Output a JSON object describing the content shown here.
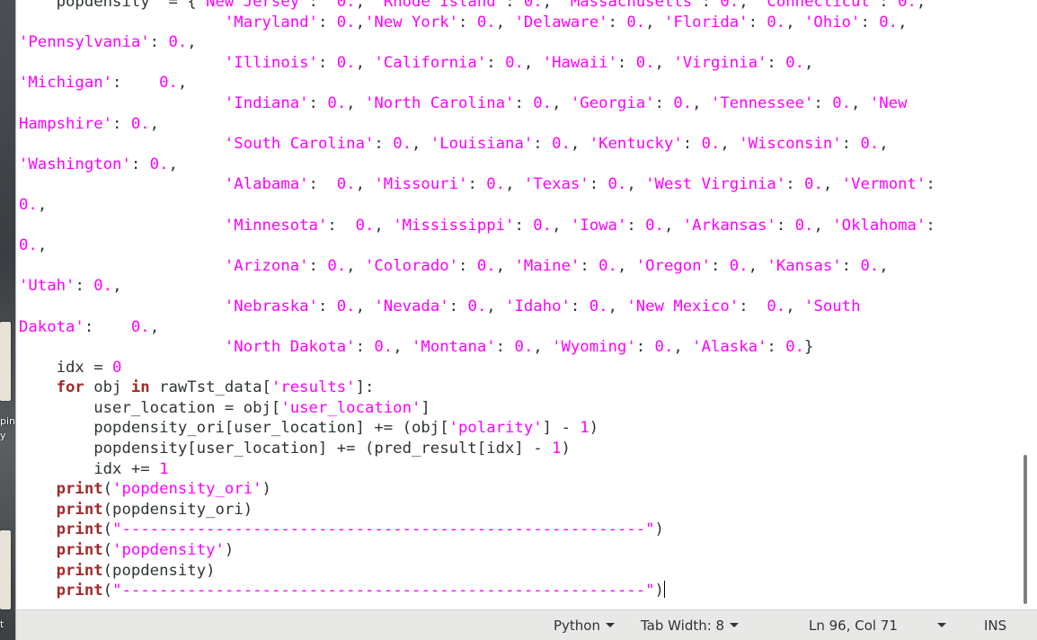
{
  "desktop": {
    "label_fragment_1": "pin",
    "label_fragment_2": "y",
    "label_fragment_3": "t"
  },
  "editor": {
    "code_lines": [
      [
        [
          "    popdensity  = {",
          "plain"
        ],
        [
          "'New Jersey'",
          "str"
        ],
        [
          ":  ",
          "plain"
        ],
        [
          "0.",
          "num"
        ],
        [
          ", ",
          "plain"
        ],
        [
          "'Rhode Island'",
          "str"
        ],
        [
          ": ",
          "plain"
        ],
        [
          "0.",
          "num"
        ],
        [
          ", ",
          "plain"
        ],
        [
          "'Massachusetts'",
          "str"
        ],
        [
          ": ",
          "plain"
        ],
        [
          "0.",
          "num"
        ],
        [
          ", ",
          "plain"
        ],
        [
          "'Connecticut'",
          "str"
        ],
        [
          ": ",
          "plain"
        ],
        [
          "0.",
          "num"
        ],
        [
          ",",
          "plain"
        ]
      ],
      [
        [
          "                      ",
          "plain"
        ],
        [
          "'Maryland'",
          "str"
        ],
        [
          ": ",
          "plain"
        ],
        [
          "0.",
          "num"
        ],
        [
          ",",
          "plain"
        ],
        [
          "'New York'",
          "str"
        ],
        [
          ": ",
          "plain"
        ],
        [
          "0.",
          "num"
        ],
        [
          ", ",
          "plain"
        ],
        [
          "'Delaware'",
          "str"
        ],
        [
          ": ",
          "plain"
        ],
        [
          "0.",
          "num"
        ],
        [
          ", ",
          "plain"
        ],
        [
          "'Florida'",
          "str"
        ],
        [
          ": ",
          "plain"
        ],
        [
          "0.",
          "num"
        ],
        [
          ", ",
          "plain"
        ],
        [
          "'Ohio'",
          "str"
        ],
        [
          ": ",
          "plain"
        ],
        [
          "0.",
          "num"
        ],
        [
          ",",
          "plain"
        ]
      ],
      [
        [
          "'Pennsylvania'",
          "str"
        ],
        [
          ": ",
          "plain"
        ],
        [
          "0.",
          "num"
        ],
        [
          ",",
          "plain"
        ]
      ],
      [
        [
          "                      ",
          "plain"
        ],
        [
          "'Illinois'",
          "str"
        ],
        [
          ": ",
          "plain"
        ],
        [
          "0.",
          "num"
        ],
        [
          ", ",
          "plain"
        ],
        [
          "'California'",
          "str"
        ],
        [
          ": ",
          "plain"
        ],
        [
          "0.",
          "num"
        ],
        [
          ", ",
          "plain"
        ],
        [
          "'Hawaii'",
          "str"
        ],
        [
          ": ",
          "plain"
        ],
        [
          "0.",
          "num"
        ],
        [
          ", ",
          "plain"
        ],
        [
          "'Virginia'",
          "str"
        ],
        [
          ": ",
          "plain"
        ],
        [
          "0.",
          "num"
        ],
        [
          ",",
          "plain"
        ]
      ],
      [
        [
          "'Michigan'",
          "str"
        ],
        [
          ":    ",
          "plain"
        ],
        [
          "0.",
          "num"
        ],
        [
          ",",
          "plain"
        ]
      ],
      [
        [
          "                      ",
          "plain"
        ],
        [
          "'Indiana'",
          "str"
        ],
        [
          ": ",
          "plain"
        ],
        [
          "0.",
          "num"
        ],
        [
          ", ",
          "plain"
        ],
        [
          "'North Carolina'",
          "str"
        ],
        [
          ": ",
          "plain"
        ],
        [
          "0.",
          "num"
        ],
        [
          ", ",
          "plain"
        ],
        [
          "'Georgia'",
          "str"
        ],
        [
          ": ",
          "plain"
        ],
        [
          "0.",
          "num"
        ],
        [
          ", ",
          "plain"
        ],
        [
          "'Tennessee'",
          "str"
        ],
        [
          ": ",
          "plain"
        ],
        [
          "0.",
          "num"
        ],
        [
          ", ",
          "plain"
        ],
        [
          "'New",
          "str"
        ]
      ],
      [
        [
          "Hampshire'",
          "str"
        ],
        [
          ": ",
          "plain"
        ],
        [
          "0.",
          "num"
        ],
        [
          ",",
          "plain"
        ]
      ],
      [
        [
          "                      ",
          "plain"
        ],
        [
          "'South Carolina'",
          "str"
        ],
        [
          ": ",
          "plain"
        ],
        [
          "0.",
          "num"
        ],
        [
          ", ",
          "plain"
        ],
        [
          "'Louisiana'",
          "str"
        ],
        [
          ": ",
          "plain"
        ],
        [
          "0.",
          "num"
        ],
        [
          ", ",
          "plain"
        ],
        [
          "'Kentucky'",
          "str"
        ],
        [
          ": ",
          "plain"
        ],
        [
          "0.",
          "num"
        ],
        [
          ", ",
          "plain"
        ],
        [
          "'Wisconsin'",
          "str"
        ],
        [
          ": ",
          "plain"
        ],
        [
          "0.",
          "num"
        ],
        [
          ",",
          "plain"
        ]
      ],
      [
        [
          "'Washington'",
          "str"
        ],
        [
          ": ",
          "plain"
        ],
        [
          "0.",
          "num"
        ],
        [
          ",",
          "plain"
        ]
      ],
      [
        [
          "                      ",
          "plain"
        ],
        [
          "'Alabama'",
          "str"
        ],
        [
          ":  ",
          "plain"
        ],
        [
          "0.",
          "num"
        ],
        [
          ", ",
          "plain"
        ],
        [
          "'Missouri'",
          "str"
        ],
        [
          ": ",
          "plain"
        ],
        [
          "0.",
          "num"
        ],
        [
          ", ",
          "plain"
        ],
        [
          "'Texas'",
          "str"
        ],
        [
          ": ",
          "plain"
        ],
        [
          "0.",
          "num"
        ],
        [
          ", ",
          "plain"
        ],
        [
          "'West Virginia'",
          "str"
        ],
        [
          ": ",
          "plain"
        ],
        [
          "0.",
          "num"
        ],
        [
          ", ",
          "plain"
        ],
        [
          "'Vermont'",
          "str"
        ],
        [
          ":",
          "plain"
        ]
      ],
      [
        [
          "0.",
          "num"
        ],
        [
          ",",
          "plain"
        ]
      ],
      [
        [
          "                      ",
          "plain"
        ],
        [
          "'Minnesota'",
          "str"
        ],
        [
          ":  ",
          "plain"
        ],
        [
          "0.",
          "num"
        ],
        [
          ", ",
          "plain"
        ],
        [
          "'Mississippi'",
          "str"
        ],
        [
          ": ",
          "plain"
        ],
        [
          "0.",
          "num"
        ],
        [
          ", ",
          "plain"
        ],
        [
          "'Iowa'",
          "str"
        ],
        [
          ": ",
          "plain"
        ],
        [
          "0.",
          "num"
        ],
        [
          ", ",
          "plain"
        ],
        [
          "'Arkansas'",
          "str"
        ],
        [
          ": ",
          "plain"
        ],
        [
          "0.",
          "num"
        ],
        [
          ", ",
          "plain"
        ],
        [
          "'Oklahoma'",
          "str"
        ],
        [
          ":",
          "plain"
        ]
      ],
      [
        [
          "0.",
          "num"
        ],
        [
          ",",
          "plain"
        ]
      ],
      [
        [
          "                      ",
          "plain"
        ],
        [
          "'Arizona'",
          "str"
        ],
        [
          ": ",
          "plain"
        ],
        [
          "0.",
          "num"
        ],
        [
          ", ",
          "plain"
        ],
        [
          "'Colorado'",
          "str"
        ],
        [
          ": ",
          "plain"
        ],
        [
          "0.",
          "num"
        ],
        [
          ", ",
          "plain"
        ],
        [
          "'Maine'",
          "str"
        ],
        [
          ": ",
          "plain"
        ],
        [
          "0.",
          "num"
        ],
        [
          ", ",
          "plain"
        ],
        [
          "'Oregon'",
          "str"
        ],
        [
          ": ",
          "plain"
        ],
        [
          "0.",
          "num"
        ],
        [
          ", ",
          "plain"
        ],
        [
          "'Kansas'",
          "str"
        ],
        [
          ": ",
          "plain"
        ],
        [
          "0.",
          "num"
        ],
        [
          ",",
          "plain"
        ]
      ],
      [
        [
          "'Utah'",
          "str"
        ],
        [
          ": ",
          "plain"
        ],
        [
          "0.",
          "num"
        ],
        [
          ",",
          "plain"
        ]
      ],
      [
        [
          "                      ",
          "plain"
        ],
        [
          "'Nebraska'",
          "str"
        ],
        [
          ": ",
          "plain"
        ],
        [
          "0.",
          "num"
        ],
        [
          ", ",
          "plain"
        ],
        [
          "'Nevada'",
          "str"
        ],
        [
          ": ",
          "plain"
        ],
        [
          "0.",
          "num"
        ],
        [
          ", ",
          "plain"
        ],
        [
          "'Idaho'",
          "str"
        ],
        [
          ": ",
          "plain"
        ],
        [
          "0.",
          "num"
        ],
        [
          ", ",
          "plain"
        ],
        [
          "'New Mexico'",
          "str"
        ],
        [
          ":  ",
          "plain"
        ],
        [
          "0.",
          "num"
        ],
        [
          ", ",
          "plain"
        ],
        [
          "'South",
          "str"
        ]
      ],
      [
        [
          "Dakota'",
          "str"
        ],
        [
          ":    ",
          "plain"
        ],
        [
          "0.",
          "num"
        ],
        [
          ",",
          "plain"
        ]
      ],
      [
        [
          "                      ",
          "plain"
        ],
        [
          "'North Dakota'",
          "str"
        ],
        [
          ": ",
          "plain"
        ],
        [
          "0.",
          "num"
        ],
        [
          ", ",
          "plain"
        ],
        [
          "'Montana'",
          "str"
        ],
        [
          ": ",
          "plain"
        ],
        [
          "0.",
          "num"
        ],
        [
          ", ",
          "plain"
        ],
        [
          "'Wyoming'",
          "str"
        ],
        [
          ": ",
          "plain"
        ],
        [
          "0.",
          "num"
        ],
        [
          ", ",
          "plain"
        ],
        [
          "'Alaska'",
          "str"
        ],
        [
          ": ",
          "plain"
        ],
        [
          "0.",
          "num"
        ],
        [
          "}",
          "plain"
        ]
      ],
      [
        [
          "    idx = ",
          "plain"
        ],
        [
          "0",
          "num"
        ]
      ],
      [
        [
          "    ",
          "plain"
        ],
        [
          "for",
          "kw"
        ],
        [
          " obj ",
          "plain"
        ],
        [
          "in",
          "kw"
        ],
        [
          " rawTst_data[",
          "plain"
        ],
        [
          "'results'",
          "str"
        ],
        [
          "]:",
          "plain"
        ]
      ],
      [
        [
          "        user_location = obj[",
          "plain"
        ],
        [
          "'user_location'",
          "str"
        ],
        [
          "]",
          "plain"
        ]
      ],
      [
        [
          "        popdensity_ori[user_location] += (obj[",
          "plain"
        ],
        [
          "'polarity'",
          "str"
        ],
        [
          "] - ",
          "plain"
        ],
        [
          "1",
          "num"
        ],
        [
          ")",
          "plain"
        ]
      ],
      [
        [
          "        popdensity[user_location] += (pred_result[idx] - ",
          "plain"
        ],
        [
          "1",
          "num"
        ],
        [
          ")",
          "plain"
        ]
      ],
      [
        [
          "        idx += ",
          "plain"
        ],
        [
          "1",
          "num"
        ]
      ],
      [
        [
          "    ",
          "plain"
        ],
        [
          "print",
          "fn"
        ],
        [
          "(",
          "plain"
        ],
        [
          "'popdensity_ori'",
          "str"
        ],
        [
          ")",
          "plain"
        ]
      ],
      [
        [
          "    ",
          "plain"
        ],
        [
          "print",
          "fn"
        ],
        [
          "(popdensity_ori)",
          "plain"
        ]
      ],
      [
        [
          "    ",
          "plain"
        ],
        [
          "print",
          "fn"
        ],
        [
          "(",
          "plain"
        ],
        [
          "\"--------------------------------------------------------\"",
          "str"
        ],
        [
          ")",
          "plain"
        ]
      ],
      [
        [
          "    ",
          "plain"
        ],
        [
          "print",
          "fn"
        ],
        [
          "(",
          "plain"
        ],
        [
          "'popdensity'",
          "str"
        ],
        [
          ")",
          "plain"
        ]
      ],
      [
        [
          "    ",
          "plain"
        ],
        [
          "print",
          "fn"
        ],
        [
          "(popdensity)",
          "plain"
        ]
      ],
      [
        [
          "    ",
          "plain"
        ],
        [
          "print",
          "fn"
        ],
        [
          "(",
          "plain"
        ],
        [
          "\"--------------------------------------------------------\"",
          "str"
        ],
        [
          ")",
          "plain"
        ]
      ]
    ],
    "cursor_line": 29
  },
  "status_bar": {
    "language": "Python",
    "tab_width": "Tab Width: 8",
    "position": "Ln 96, Col 71",
    "mode": "INS"
  },
  "colors": {
    "string": "#ff00ff",
    "keyword": "#a52a2a",
    "text": "#2e3436",
    "background": "#ffffff",
    "status_bar": "#e8e8e7"
  }
}
